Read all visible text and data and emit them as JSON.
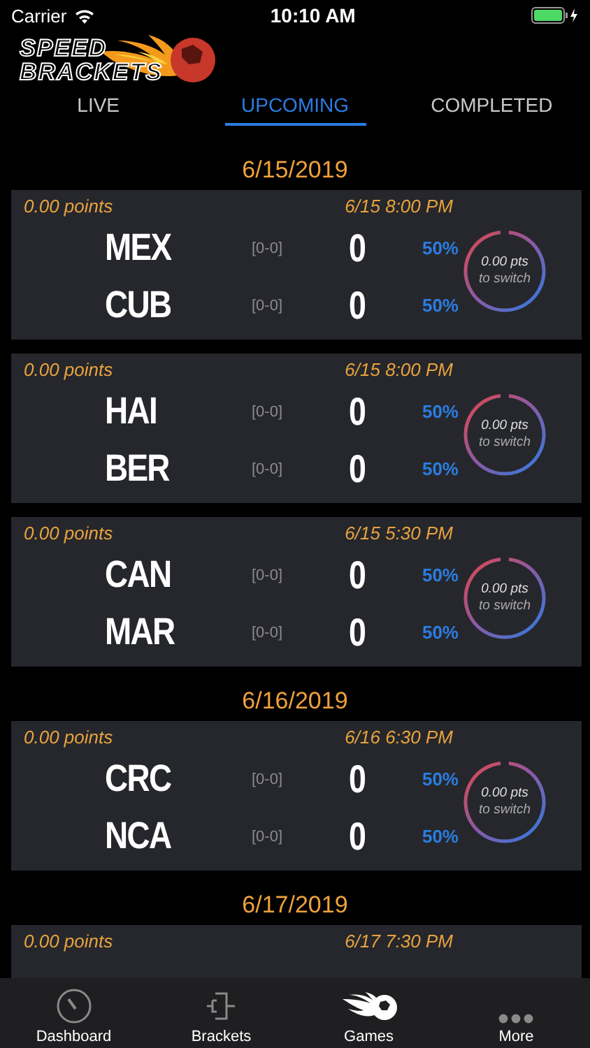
{
  "status_bar": {
    "carrier": "Carrier",
    "time": "10:10 AM"
  },
  "logo": {
    "lines": [
      "SPEED",
      "BRACKETS"
    ]
  },
  "tabs": [
    {
      "label": "LIVE",
      "selected": false
    },
    {
      "label": "UPCOMING",
      "selected": true
    },
    {
      "label": "COMPLETED",
      "selected": false
    }
  ],
  "sections": [
    {
      "date": "6/15/2019",
      "games": [
        {
          "points": "0.00 points",
          "time": "6/15 8:00 PM",
          "teams": [
            {
              "code": "MEX",
              "record": "[0-0]",
              "score": "0",
              "percent": "50%"
            },
            {
              "code": "CUB",
              "record": "[0-0]",
              "score": "0",
              "percent": "50%"
            }
          ],
          "ring": {
            "value": "0.00 pts",
            "caption": "to switch"
          }
        },
        {
          "points": "0.00 points",
          "time": "6/15 8:00 PM",
          "teams": [
            {
              "code": "HAI",
              "record": "[0-0]",
              "score": "0",
              "percent": "50%"
            },
            {
              "code": "BER",
              "record": "[0-0]",
              "score": "0",
              "percent": "50%"
            }
          ],
          "ring": {
            "value": "0.00 pts",
            "caption": "to switch"
          }
        },
        {
          "points": "0.00 points",
          "time": "6/15 5:30 PM",
          "teams": [
            {
              "code": "CAN",
              "record": "[0-0]",
              "score": "0",
              "percent": "50%"
            },
            {
              "code": "MAR",
              "record": "[0-0]",
              "score": "0",
              "percent": "50%"
            }
          ],
          "ring": {
            "value": "0.00 pts",
            "caption": "to switch"
          }
        }
      ]
    },
    {
      "date": "6/16/2019",
      "games": [
        {
          "points": "0.00 points",
          "time": "6/16 6:30 PM",
          "teams": [
            {
              "code": "CRC",
              "record": "[0-0]",
              "score": "0",
              "percent": "50%"
            },
            {
              "code": "NCA",
              "record": "[0-0]",
              "score": "0",
              "percent": "50%"
            }
          ],
          "ring": {
            "value": "0.00 pts",
            "caption": "to switch"
          }
        }
      ]
    },
    {
      "date": "6/17/2019",
      "games": [
        {
          "points": "0.00 points",
          "time": "6/17 7:30 PM"
        }
      ]
    }
  ],
  "bottom_nav": [
    {
      "kind": "dashboard",
      "label": "Dashboard",
      "selected": false
    },
    {
      "kind": "brackets",
      "label": "Brackets",
      "selected": false
    },
    {
      "kind": "games",
      "label": "Games",
      "selected": true
    },
    {
      "kind": "more",
      "label": "More",
      "selected": false
    }
  ]
}
